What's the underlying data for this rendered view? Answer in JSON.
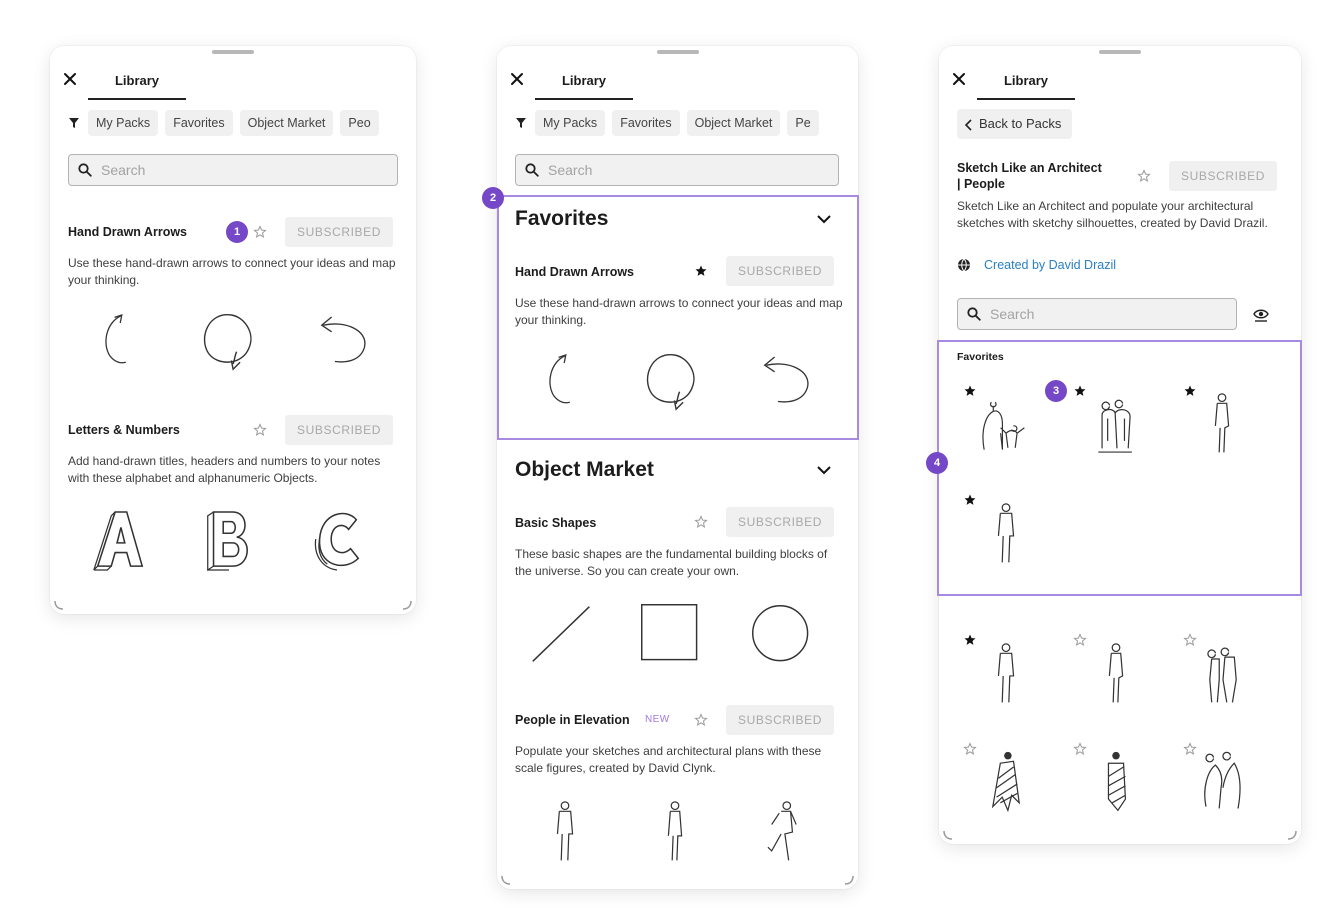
{
  "panels": [
    {
      "close_icon": "close-icon",
      "tab": "Library",
      "chips": [
        "My Packs",
        "Favorites",
        "Object Market",
        "Peo"
      ],
      "search_placeholder": "Search",
      "packs": [
        {
          "title": "Hand Drawn Arrows",
          "badge": "SUBSCRIBED",
          "description": "Use these hand-drawn arrows to connect your ideas and map your thinking.",
          "favorited": false
        },
        {
          "title": "Letters & Numbers",
          "badge": "SUBSCRIBED",
          "description": "Add hand-drawn titles, headers and numbers to your notes with these alphabet and alphanumeric Objects.",
          "favorited": false
        }
      ]
    },
    {
      "close_icon": "close-icon",
      "tab": "Library",
      "chips": [
        "My Packs",
        "Favorites",
        "Object Market",
        "Pe"
      ],
      "search_placeholder": "Search",
      "sections": [
        {
          "title": "Favorites",
          "packs": [
            {
              "title": "Hand Drawn Arrows",
              "badge": "SUBSCRIBED",
              "description": "Use these hand-drawn arrows to connect your ideas and map your thinking.",
              "favorited": true
            }
          ]
        },
        {
          "title": "Object Market",
          "packs": [
            {
              "title": "Basic Shapes",
              "badge": "SUBSCRIBED",
              "description": "These basic shapes are the fundamental building blocks of the universe. So you can create your own.",
              "favorited": false
            },
            {
              "title": "People in Elevation",
              "new_label": "NEW",
              "badge": "SUBSCRIBED",
              "description": "Populate your sketches and architectural plans with these scale figures, created by David Clynk.",
              "favorited": false
            }
          ]
        }
      ]
    },
    {
      "close_icon": "close-icon",
      "tab": "Library",
      "back_label": "Back to Packs",
      "pack_title_line1": "Sketch Like an Architect",
      "pack_title_line2": "| People",
      "badge": "SUBSCRIBED",
      "description": "Sketch Like an Architect and populate your architectural sketches with sketchy silhouettes, created by David Drazil.",
      "creator_link": "Created by David Drazil",
      "search_placeholder": "Search",
      "favorites_label": "Favorites",
      "objects_favorited": [
        true,
        true,
        true,
        true
      ],
      "objects_other_favorited": [
        true,
        false,
        false,
        false,
        false,
        false
      ]
    }
  ],
  "annotations": [
    "1",
    "2",
    "3",
    "4"
  ],
  "colors": {
    "accent_purple": "#7448c6",
    "highlight_border": "#a88ae0",
    "link_blue": "#2a7fc4",
    "badge_text": "#a8a8a8"
  }
}
